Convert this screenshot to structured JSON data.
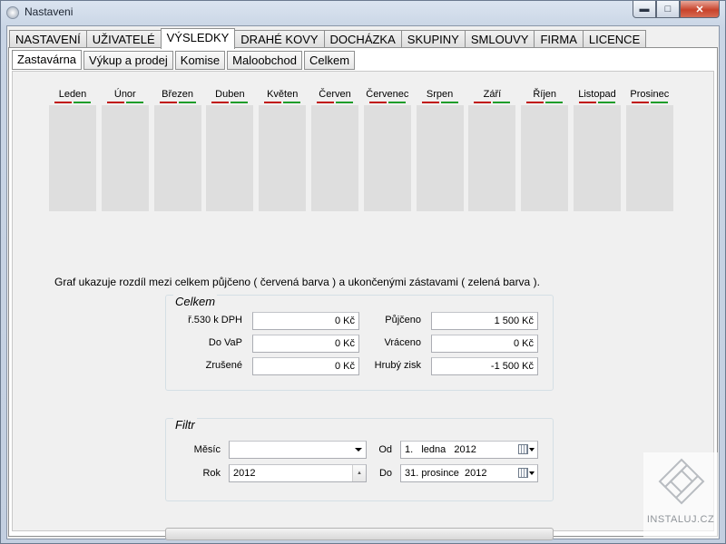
{
  "window": {
    "title": "Nastaveni"
  },
  "main_tabs": [
    {
      "label": "NASTAVENÍ"
    },
    {
      "label": "UŽIVATELÉ"
    },
    {
      "label": "VÝSLEDKY",
      "active": true
    },
    {
      "label": "DRAHÉ KOVY"
    },
    {
      "label": "DOCHÁZKA"
    },
    {
      "label": "SKUPINY"
    },
    {
      "label": "SMLOUVY"
    },
    {
      "label": "FIRMA"
    },
    {
      "label": "LICENCE"
    }
  ],
  "sub_tabs": [
    {
      "label": "Zastavárna",
      "active": true
    },
    {
      "label": "Výkup a prodej"
    },
    {
      "label": "Komise"
    },
    {
      "label": "Maloobchod"
    },
    {
      "label": "Celkem"
    }
  ],
  "months": [
    "Leden",
    "Únor",
    "Březen",
    "Duben",
    "Květen",
    "Červen",
    "Červenec",
    "Srpen",
    "Září",
    "Říjen",
    "Listopad",
    "Prosinec"
  ],
  "colors": {
    "borrowed": "#c0140e",
    "closed": "#1f9d2a",
    "bar_bg": "#dedede"
  },
  "caption": "Graf ukazuje rozdíl mezi celkem půjčeno ( červená barva ) a ukončenými zástavami ( zelená barva ).",
  "celkem": {
    "legend": "Celkem",
    "rows": [
      {
        "label": "ř.530 k DPH",
        "value": "0 Kč"
      },
      {
        "label": "Do VaP",
        "value": "0 Kč"
      },
      {
        "label": "Zrušené",
        "value": "0 Kč"
      }
    ],
    "rows_right": [
      {
        "label": "Půjčeno",
        "value": "1 500 Kč"
      },
      {
        "label": "Vráceno",
        "value": "0 Kč"
      },
      {
        "label": "Hrubý zisk",
        "value": "-1 500 Kč"
      }
    ]
  },
  "filtr": {
    "legend": "Filtr",
    "month_label": "Měsíc",
    "month_value": "",
    "year_label": "Rok",
    "year_value": "2012",
    "from_label": "Od",
    "from_value": "1.   ledna   2012",
    "to_label": "Do",
    "to_value": "31. prosince  2012"
  },
  "progress": {
    "value": 0
  },
  "watermark": {
    "text": "INSTALUJ.CZ"
  }
}
